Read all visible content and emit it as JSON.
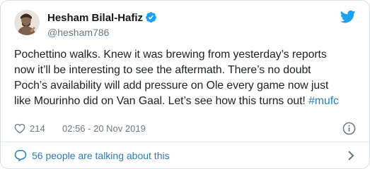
{
  "author": {
    "display_name": "Hesham Bilal-Hafiz",
    "handle": "@hesham786",
    "verified": true
  },
  "tweet": {
    "text": "Pochettino walks. Knew it was brewing from yesterday’s reports\nnow it’ll be interesting to see the aftermath. There’s no doubt\nPoch’s availability will add pressure on Ole every game now just\nlike Mourinho did on Van Gaal. Let’s see how this turns out! ",
    "hashtag": "#mufc"
  },
  "meta": {
    "like_count": "214",
    "timestamp": "02:56 - 20 Nov 2019"
  },
  "conversation": {
    "label": "56 people are talking about this"
  },
  "icons": {
    "brand": "twitter-bird-icon",
    "verified": "verified-badge-icon",
    "like": "heart-icon",
    "info": "info-icon",
    "conversation": "speech-bubble-icon",
    "chevron": "chevron-right-icon"
  },
  "colors": {
    "link": "#2b7bb9",
    "brand": "#1da1f2",
    "secondary_text": "#657786",
    "border": "#d7dee3"
  }
}
